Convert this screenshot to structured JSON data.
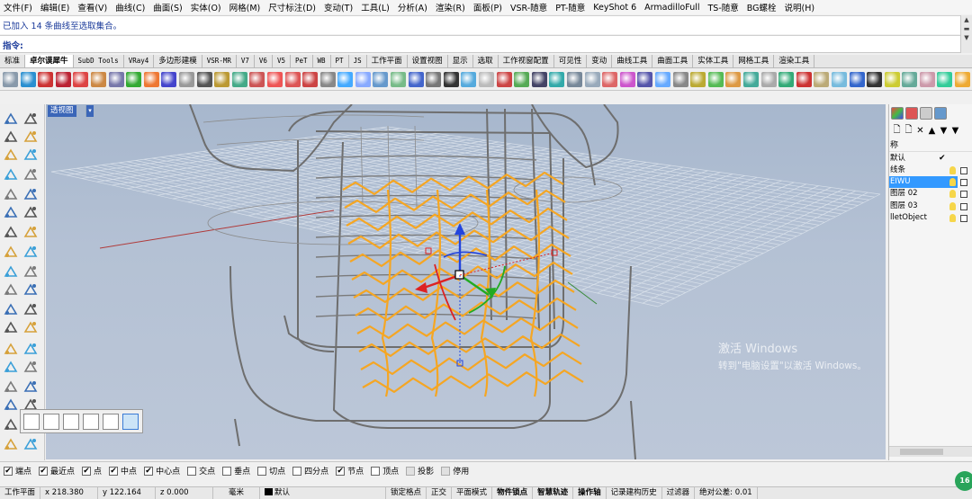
{
  "menu": [
    "文件(F)",
    "编辑(E)",
    "查看(V)",
    "曲线(C)",
    "曲面(S)",
    "实体(O)",
    "网格(M)",
    "尺寸标注(D)",
    "变动(T)",
    "工具(L)",
    "分析(A)",
    "渲染(R)",
    "面板(P)",
    "VSR-随意",
    "PT-随意",
    "KeyShot 6",
    "ArmadilloFull",
    "TS-随意",
    "BG螺栓",
    "说明(H)"
  ],
  "command": {
    "history": "已加入 14 条曲线至选取集合。",
    "prompt": "指令:"
  },
  "tabs": [
    {
      "label": "标准",
      "active": false,
      "mono": false
    },
    {
      "label": "卓尔谟犀牛",
      "active": true,
      "mono": false
    },
    {
      "label": "SubD Tools",
      "active": false,
      "mono": true
    },
    {
      "label": "VRay4",
      "active": false,
      "mono": true
    },
    {
      "label": "多边形建模",
      "active": false,
      "mono": false
    },
    {
      "label": "VSR-MR",
      "active": false,
      "mono": true
    },
    {
      "label": "V7",
      "active": false,
      "mono": true
    },
    {
      "label": "V6",
      "active": false,
      "mono": true
    },
    {
      "label": "V5",
      "active": false,
      "mono": true
    },
    {
      "label": "PeT",
      "active": false,
      "mono": true
    },
    {
      "label": "WB",
      "active": false,
      "mono": true
    },
    {
      "label": "PT",
      "active": false,
      "mono": true
    },
    {
      "label": "JS",
      "active": false,
      "mono": true
    },
    {
      "label": "工作平面",
      "active": false,
      "mono": false
    },
    {
      "label": "设置视图",
      "active": false,
      "mono": false
    },
    {
      "label": "显示",
      "active": false,
      "mono": false
    },
    {
      "label": "选取",
      "active": false,
      "mono": false
    },
    {
      "label": "工作视窗配置",
      "active": false,
      "mono": false
    },
    {
      "label": "可见性",
      "active": false,
      "mono": false
    },
    {
      "label": "变动",
      "active": false,
      "mono": false
    },
    {
      "label": "曲线工具",
      "active": false,
      "mono": false
    },
    {
      "label": "曲面工具",
      "active": false,
      "mono": false
    },
    {
      "label": "实体工具",
      "active": false,
      "mono": false
    },
    {
      "label": "网格工具",
      "active": false,
      "mono": false
    },
    {
      "label": "渲染工具",
      "active": false,
      "mono": false
    }
  ],
  "viewport": {
    "label": "透视图",
    "arrow": "▾"
  },
  "watermark": {
    "line1": "激活 Windows",
    "line2": "转到\"电脑设置\"以激活 Windows。"
  },
  "layers": {
    "header": "称",
    "rows": [
      {
        "name": "默认",
        "check": "✔"
      },
      {
        "name": "线条"
      },
      {
        "name": "EIWU",
        "selected": true
      },
      {
        "name": "图层 02"
      },
      {
        "name": "图层 03"
      },
      {
        "name": "lletObject"
      }
    ],
    "buttons": [
      "🗋",
      "🗋",
      "✕",
      "▲",
      "▼",
      "▼"
    ]
  },
  "osnap": [
    {
      "label": "端点",
      "checked": true
    },
    {
      "label": "最近点",
      "checked": true
    },
    {
      "label": "点",
      "checked": true
    },
    {
      "label": "中点",
      "checked": true
    },
    {
      "label": "中心点",
      "checked": true
    },
    {
      "label": "交点",
      "checked": false
    },
    {
      "label": "垂点",
      "checked": false
    },
    {
      "label": "切点",
      "checked": false
    },
    {
      "label": "四分点",
      "checked": false
    },
    {
      "label": "节点",
      "checked": true
    },
    {
      "label": "顶点",
      "checked": false
    },
    {
      "label": "投影",
      "checked": false,
      "gray": true
    },
    {
      "label": "停用",
      "checked": false,
      "gray": true
    }
  ],
  "status": {
    "cplane": "工作平面",
    "x": "x 218.380",
    "y": "y 122.164",
    "z": "z 0.000",
    "unit": "毫米",
    "layer": "默认",
    "items": [
      "锁定格点",
      "正交",
      "平面模式",
      "物件锁点",
      "智慧轨迹",
      "操作轴",
      "记录建构历史",
      "过滤器",
      "绝对公差: 0.01"
    ],
    "bold": [
      "物件锁点",
      "智慧轨迹",
      "操作轴"
    ]
  },
  "badge": "16",
  "colors": {
    "viewport_bg": "#b4c1d4",
    "curves": "#f5a623",
    "wire": "#6e6e6e",
    "selected_layer": "#3399ff"
  }
}
